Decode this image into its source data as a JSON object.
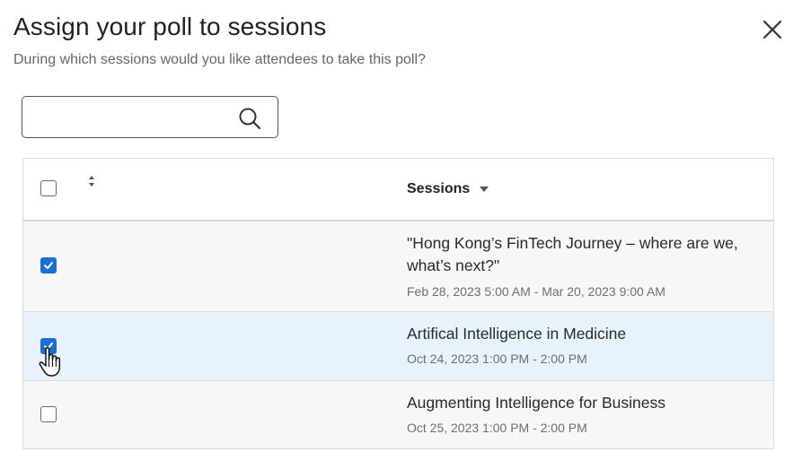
{
  "dialog": {
    "title": "Assign your poll to sessions",
    "subtitle": "During which sessions would you like attendees to take this poll?",
    "close_icon": "close-icon"
  },
  "search": {
    "value": "",
    "placeholder": "",
    "icon": "search-icon"
  },
  "table": {
    "select_all_checked": false,
    "sort_icon": "sort-up-down-icon",
    "column_header": "Sessions",
    "column_sort_icon": "caret-down-icon",
    "rows": [
      {
        "checked": true,
        "title": "\"Hong Kong’s FinTech Journey – where are we, what’s next?\"",
        "date": "Feb 28, 2023 5:00 AM - Mar 20, 2023 9:00 AM"
      },
      {
        "checked": true,
        "title": "Artifical Intelligence in Medicine",
        "date": "Oct 24, 2023 1:00 PM - 2:00 PM"
      },
      {
        "checked": false,
        "title": "Augmenting Intelligence for Business",
        "date": "Oct 25, 2023 1:00 PM - 2:00 PM"
      }
    ]
  },
  "colors": {
    "accent": "#1c6fd1",
    "hover_row": "#e8f2fc",
    "row_bg": "#f7f7f8"
  }
}
